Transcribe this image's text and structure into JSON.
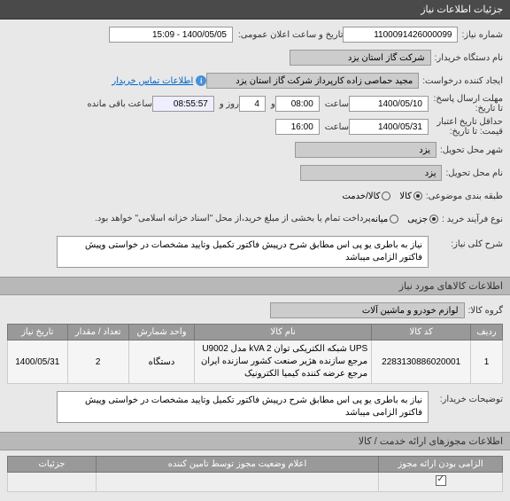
{
  "panel_title": "جزئیات اطلاعات نیاز",
  "form": {
    "need_no_label": "شماره نیاز:",
    "need_no": "1100091426000099",
    "announce_label": "تاریخ و ساعت اعلان عمومی:",
    "announce_value": "1400/05/05 - 15:09",
    "buyer_label": "نام دستگاه خریدار:",
    "buyer_value": "شرکت گاز استان یزد",
    "requester_label": "ایجاد کننده درخواست:",
    "requester_value": "مجید حماصی زاده کارپرداز شرکت گاز استان یزد",
    "contact_link": "اطلاعات تماس خریدار",
    "send_deadline_label": "مهلت ارسال پاسخ:",
    "send_deadline_date_label": "تا تاریخ:",
    "send_deadline_date": "1400/05/10",
    "send_deadline_time_label": "ساعت",
    "send_deadline_time": "08:00",
    "send_deadline_days_label": "و",
    "send_deadline_days": "4",
    "send_deadline_days_suffix": "روز و",
    "remaining_time": "08:55:57",
    "remaining_label": "ساعت باقی مانده",
    "validity_label": "حداقل تاریخ اعتبار",
    "validity_label2": "قیمت: تا تاریخ:",
    "validity_date": "1400/05/31",
    "validity_time_label": "ساعت",
    "validity_time": "16:00",
    "delivery_city_label": "شهر محل تحویل:",
    "delivery_city": "یزد",
    "delivery_name_label": "نام محل تحویل:",
    "delivery_name": "یزد",
    "category_label": "طبقه بندی موضوعی:",
    "category_goods": "کالا",
    "category_service": "کالا/خدمت",
    "process_type_label": "نوع فرآیند خرید :",
    "process_partial": "جزیی",
    "process_middle": "میانه",
    "payment_note": "پرداخت تمام یا بخشی از مبلغ خرید،از محل \"اسناد خزانه اسلامی\" خواهد بود."
  },
  "desc": {
    "title": "شرح کلی نیاز:",
    "text": "نیاز به باطری یو پی اس مطابق شرح درپیش فاکتور\nتکمیل وتایید مشخصات در خواستی وپیش فاکتور الزامی میباشد"
  },
  "goods_section": "اطلاعات کالاهای مورد نیاز",
  "goods_group_label": "گروه کالا:",
  "goods_group_value": "لوازم خودرو و ماشین آلات",
  "table": {
    "headers": [
      "ردیف",
      "کد کالا",
      "نام کالا",
      "واحد شمارش",
      "تعداد / مقدار",
      "تاریخ نیاز"
    ],
    "row": {
      "idx": "1",
      "code": "2283130886020001",
      "name": "UPS شبکه الکتریکی توان kVA 2 مدل U9002 مرجع سازنده هژیر صنعت کشور سازنده ایران مرجع عرضه کننده کیمیا الکترونیک",
      "unit": "دستگاه",
      "qty": "2",
      "date": "1400/05/31"
    }
  },
  "notes_label": "توضیحات خریدار:",
  "notes_text": "نیاز به باطری یو پی اس مطابق شرح درپیش فاکتور\nتکمیل وتایید مشخصات در خواستی وپیش فاکتور الزامی میباشد",
  "license_section": "اطلاعات مجوزهای ارائه خدمت / کالا",
  "bottom": {
    "col1": "الزامی بودن ارائه مجوز",
    "col2": "اعلام وضعیت مجوز توسط تامین کننده",
    "col3": "جزئیات"
  }
}
